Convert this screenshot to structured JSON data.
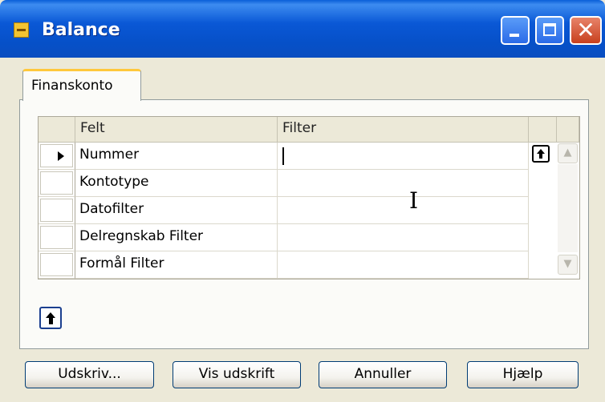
{
  "window": {
    "title": "Balance",
    "controls": [
      "minimize-icon",
      "maximize-icon",
      "close-icon"
    ]
  },
  "tabs": [
    {
      "label": "Finanskonto",
      "selected": true
    }
  ],
  "grid": {
    "columns": [
      "Felt",
      "Filter"
    ],
    "rows": [
      {
        "felt": "Nummer",
        "filter": "",
        "current": true
      },
      {
        "felt": "Kontotype",
        "filter": ""
      },
      {
        "felt": "Datofilter",
        "filter": ""
      },
      {
        "felt": "Delregnskab Filter",
        "filter": ""
      },
      {
        "felt": "Formål Filter",
        "filter": ""
      }
    ]
  },
  "buttons": {
    "print": "Udskriv...",
    "preview": "Vis udskrift",
    "cancel": "Annuller",
    "help": "Hjælp"
  },
  "colors": {
    "titlebar": "#0a58d6",
    "tab_highlight": "#ffc83c",
    "dialog_bg": "#ece9d8"
  }
}
